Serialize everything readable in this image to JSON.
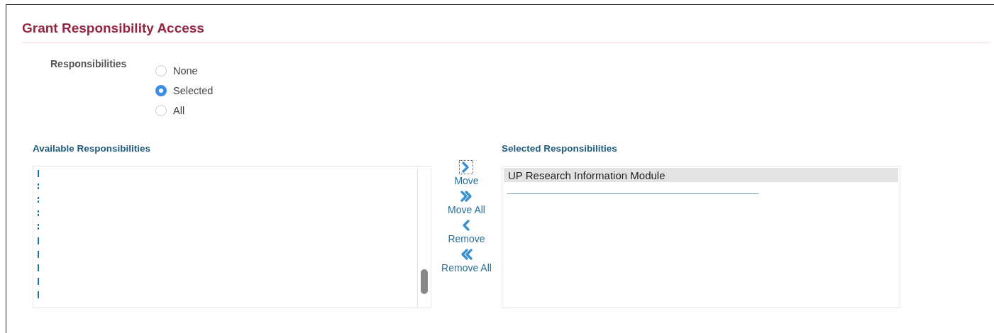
{
  "page": {
    "title": "Grant Responsibility Access"
  },
  "responsibilities": {
    "label": "Responsibilities",
    "options": [
      {
        "label": "None",
        "selected": false
      },
      {
        "label": "Selected",
        "selected": true
      },
      {
        "label": "All",
        "selected": false
      }
    ]
  },
  "available": {
    "heading": "Available Responsibilities",
    "items": [
      {
        "kind": "bar"
      },
      {
        "kind": "dotted"
      },
      {
        "kind": "dotted"
      },
      {
        "kind": "dotted"
      },
      {
        "kind": "dotted"
      },
      {
        "kind": "bar"
      },
      {
        "kind": "bar"
      },
      {
        "kind": "bar"
      },
      {
        "kind": "bar"
      },
      {
        "kind": "bar"
      }
    ]
  },
  "actions": [
    {
      "kind": "move",
      "label": "Move",
      "focused": true
    },
    {
      "kind": "move_all",
      "label": "Move All",
      "focused": false
    },
    {
      "kind": "remove",
      "label": "Remove",
      "focused": false
    },
    {
      "kind": "remove_all",
      "label": "Remove All",
      "focused": false
    }
  ],
  "selected": {
    "heading": "Selected Responsibilities",
    "items": [
      {
        "label": "UP Research Information Module",
        "selected": true
      }
    ]
  }
}
